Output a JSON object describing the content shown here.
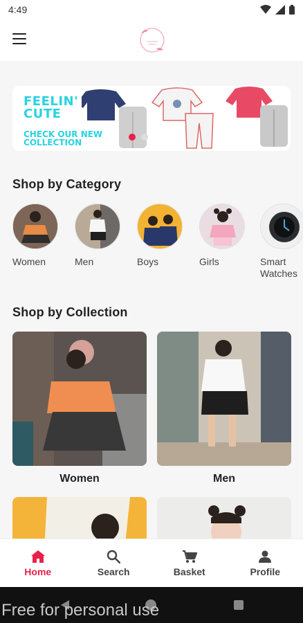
{
  "status": {
    "time": "4:49"
  },
  "banner": {
    "line1": "FEELIN' CUTE",
    "line2": "CHECK OUR NEW COLLECTION"
  },
  "sections": {
    "category_title": "Shop by Category",
    "collection_title": "Shop by Collection"
  },
  "categories": [
    {
      "label": "Women",
      "icon": "women-photo"
    },
    {
      "label": "Men",
      "icon": "men-photo"
    },
    {
      "label": "Boys",
      "icon": "boys-photo"
    },
    {
      "label": "Girls",
      "icon": "girls-photo"
    },
    {
      "label": "Smart Watches",
      "icon": "smartwatch-photo"
    }
  ],
  "collections": [
    {
      "label": "Women"
    },
    {
      "label": "Men"
    }
  ],
  "bottom_nav": [
    {
      "label": "Home",
      "icon": "home-icon",
      "active": true
    },
    {
      "label": "Search",
      "icon": "search-icon",
      "active": false
    },
    {
      "label": "Basket",
      "icon": "cart-icon",
      "active": false
    },
    {
      "label": "Profile",
      "icon": "person-icon",
      "active": false
    }
  ],
  "watermark": "Free for personal use",
  "colors": {
    "accent": "#e8204a",
    "banner_text": "#29d3e0"
  }
}
